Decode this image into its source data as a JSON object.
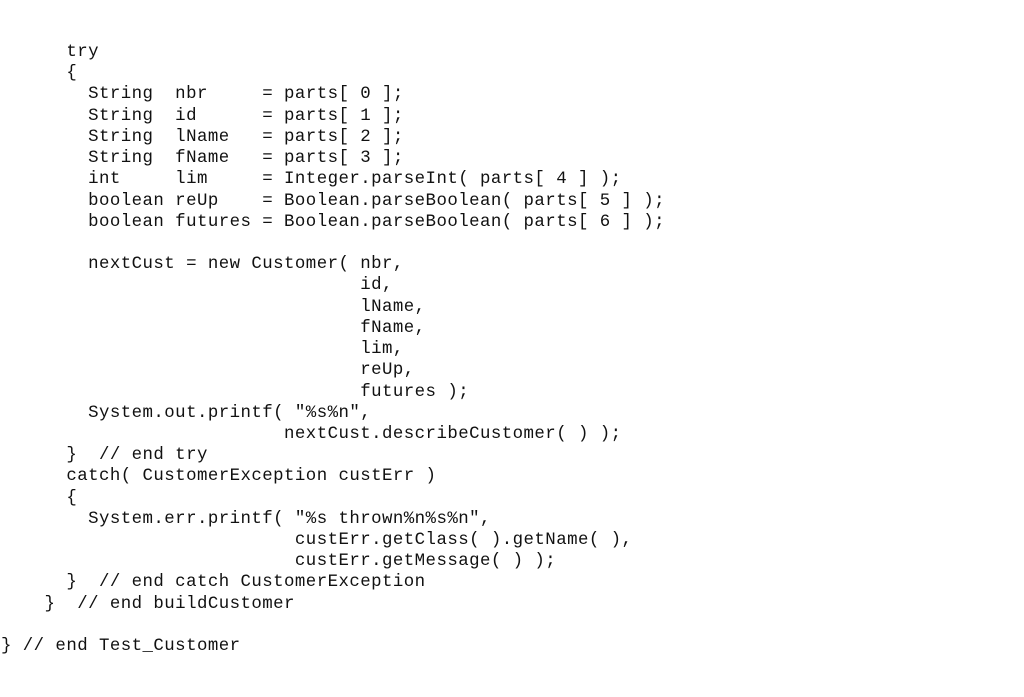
{
  "document": {
    "language": "java",
    "lines": [
      "      try",
      "      {",
      "        String  nbr     = parts[ 0 ];",
      "        String  id      = parts[ 1 ];",
      "        String  lName   = parts[ 2 ];",
      "        String  fName   = parts[ 3 ];",
      "        int     lim     = Integer.parseInt( parts[ 4 ] );",
      "        boolean reUp    = Boolean.parseBoolean( parts[ 5 ] );",
      "        boolean futures = Boolean.parseBoolean( parts[ 6 ] );",
      "",
      "        nextCust = new Customer( nbr,",
      "                                 id,",
      "                                 lName,",
      "                                 fName,",
      "                                 lim,",
      "                                 reUp,",
      "                                 futures );",
      "        System.out.printf( \"%s%n\",",
      "                          nextCust.describeCustomer( ) );",
      "      }  // end try",
      "      catch( CustomerException custErr )",
      "      {",
      "        System.err.printf( \"%s thrown%n%s%n\",",
      "                           custErr.getClass( ).getName( ),",
      "                           custErr.getMessage( ) );",
      "      }  // end catch CustomerException",
      "    }  // end buildCustomer",
      "",
      "} // end Test_Customer"
    ]
  }
}
